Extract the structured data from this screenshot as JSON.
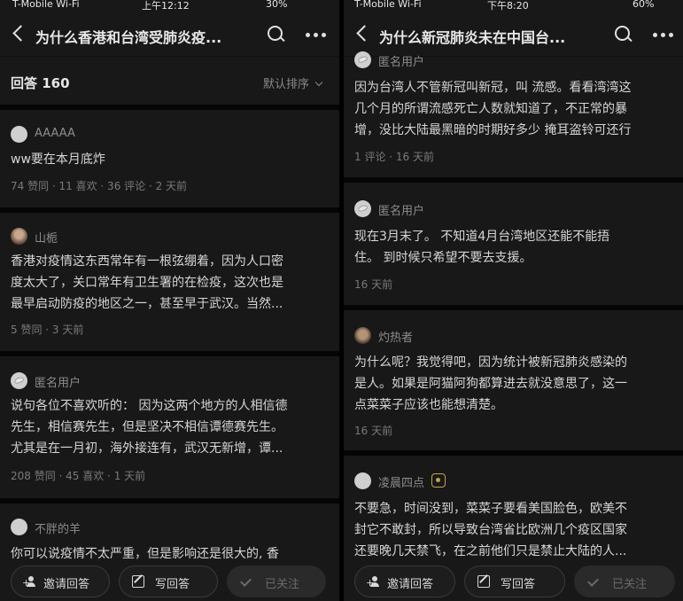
{
  "left": {
    "status": {
      "carrier": "T-Mobile Wi-Fi",
      "time": "上午12:12",
      "battery": "30%"
    },
    "nav": {
      "title": "为什么香港和台湾受肺炎疫..."
    },
    "answers_header": {
      "count_label": "回答 160",
      "sort_label": "默认排序"
    },
    "answers": [
      {
        "user": "AAAAA",
        "lines": [
          "ww要在本月底炸"
        ],
        "meta": "74 赞同 · 11 喜欢 · 36 评论 · 2 天前"
      },
      {
        "user": "山栀",
        "lines": [
          "香港对疫情这东西常年有一根弦绷着，因为人口密",
          "度太大了，关口常年有卫生署的在检疫，这次也是",
          "最早启动防疫的地区之一，甚至早于武汉。当然..."
        ],
        "meta": "5 赞同 · 3 天前"
      },
      {
        "user": "匿名用户",
        "lines": [
          "说句各位不喜欢听的： 因为这两个地方的人相信德",
          "先生，相信赛先生，但是坚决不相信谭德赛先生。",
          "尤其是在一月初，海外接连有，武汉无新增，谭..."
        ],
        "meta": "208 赞同 · 45 喜欢 · 1 天前"
      },
      {
        "user": "不胖的羊",
        "lines": [
          "你可以说疫情不太严重，但是影响还是很大的, 香"
        ],
        "meta": ""
      }
    ],
    "bottom": {
      "invite": "邀请回答",
      "write": "写回答",
      "follow": "已关注"
    }
  },
  "right": {
    "status": {
      "carrier": "T-Mobile Wi-Fi",
      "time": "下午8:20",
      "battery": "60%"
    },
    "nav": {
      "title": "为什么新冠肺炎未在中国台..."
    },
    "answers": [
      {
        "user": "匿名用户",
        "lines": [
          "因为台湾人不管新冠叫新冠，叫 流感。看看湾湾这",
          "几个月的所谓流感死亡人数就知道了，不正常的暴",
          "增，没比大陆最黑暗的时期好多少 掩耳盗铃可还行"
        ],
        "meta": "1 评论 · 16 天前"
      },
      {
        "user": "匿名用户",
        "lines": [
          "现在3月末了。 不知道4月台湾地区还能不能捂",
          "住。 到时候只希望不要去支援。"
        ],
        "meta": "16 天前"
      },
      {
        "user": "灼热者",
        "lines": [
          "为什么呢？我觉得吧，因为统计被新冠肺炎感染的",
          "是人。如果是阿猫阿狗都算进去就没意思了，这一",
          "点菜菜子应该也能想清楚。"
        ],
        "meta": "16 天前"
      },
      {
        "user": "凌晨四点",
        "lines": [
          "不要急，时间没到，菜菜子要看美国脸色，欧美不",
          "封它不敢封，所以导致台湾省比欧洲几个疫区国家",
          "还要晚几天禁飞，在之前他们只是禁止大陆的人..."
        ],
        "meta": ""
      }
    ],
    "bottom": {
      "invite": "邀请回答",
      "write": "写回答",
      "follow": "已关注"
    }
  }
}
